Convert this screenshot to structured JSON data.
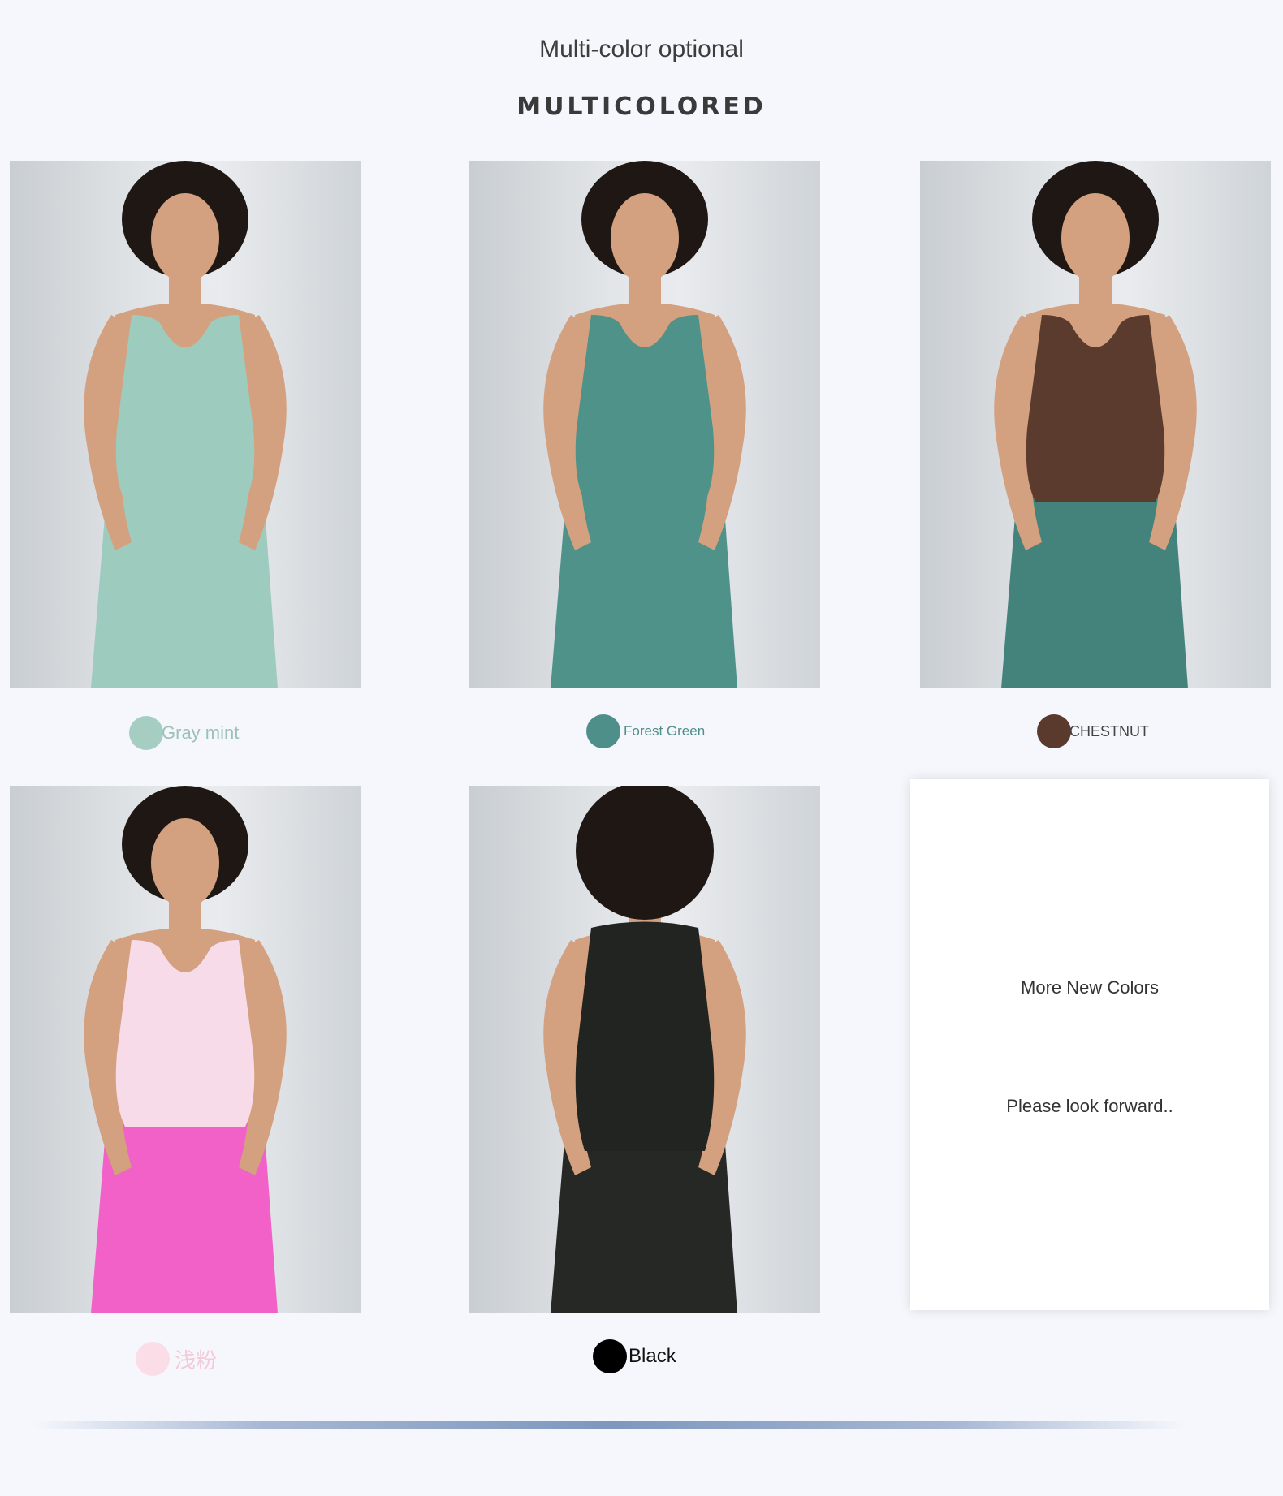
{
  "header": {
    "subtitle": "Multi-color optional",
    "title": "MULTICOLORED"
  },
  "products": [
    {
      "label": "Gray mint",
      "swatch_color": "#a6cdc2",
      "label_color": "#9bc2b8",
      "top_color": "#9dcbbd",
      "bottom_color": "#9dcbbd"
    },
    {
      "label": "Forest Green",
      "swatch_color": "#4f8f8a",
      "label_color": "#4f8f8a",
      "top_color": "#4e928a",
      "bottom_color": "#4e928a"
    },
    {
      "label": "CHESTNUT",
      "swatch_color": "#5a3a2c",
      "label_color": "#444444",
      "top_color": "#5b3b2d",
      "bottom_color": "#44827c"
    },
    {
      "label": "浅粉",
      "swatch_color": "#fbdde8",
      "label_color": "#f5c9d8",
      "top_color": "#f7dbe8",
      "bottom_color": "#f261c8"
    },
    {
      "label": "Black",
      "swatch_color": "#000000",
      "label_color": "#111111",
      "top_color": "#222422",
      "bottom_color": "#262826"
    }
  ],
  "more_card": {
    "title": "More New Colors",
    "subtitle": "Please look forward.."
  },
  "colors": {
    "page_background": "#f5f7fc",
    "divider": "#7d97be"
  }
}
